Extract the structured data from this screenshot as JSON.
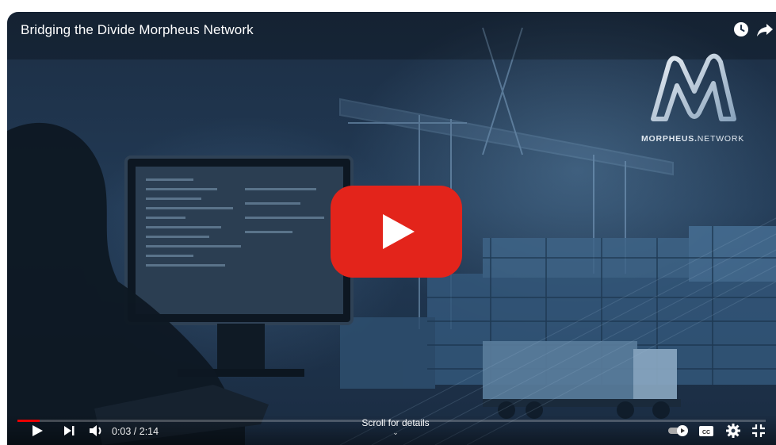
{
  "video": {
    "title": "Bridging the Divide Morpheus Network",
    "brand_name_bold": "MORPHEUS.",
    "brand_name_rest": "NETWORK"
  },
  "controls": {
    "time_display": "0:03 / 2:14",
    "scroll_hint": "Scroll for details",
    "progress_fraction": 0.03
  },
  "colors": {
    "accent": "#ff0000",
    "play_button": "#e3241b"
  },
  "icons": {
    "watch_later": "clock-icon",
    "share": "share-icon",
    "play": "play-icon",
    "next": "next-icon",
    "volume": "volume-icon",
    "autoplay": "autoplay-toggle-icon",
    "captions": "cc-icon",
    "settings": "gear-icon",
    "fullscreen": "exit-fullscreen-icon"
  }
}
